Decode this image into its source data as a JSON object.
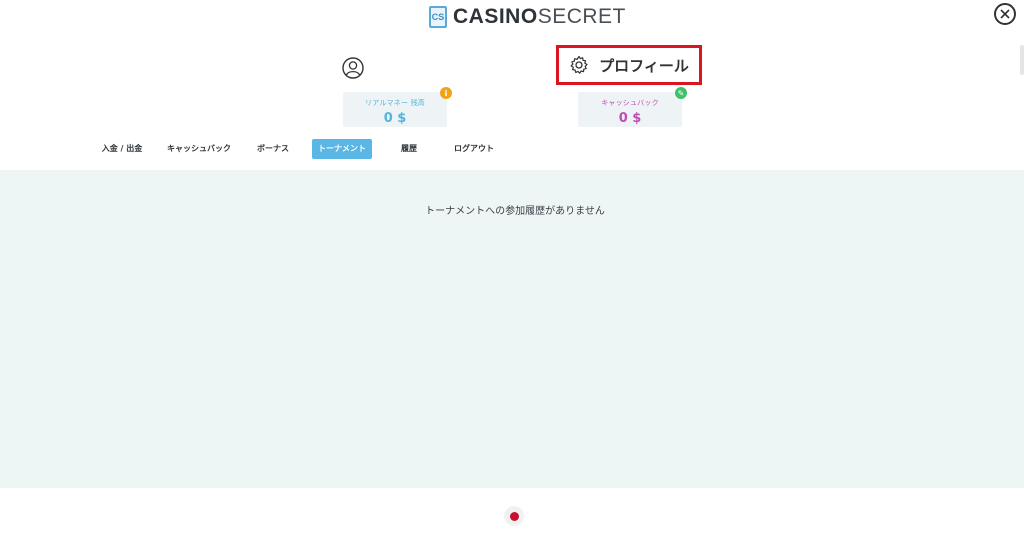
{
  "header": {
    "logo_mark": "CS",
    "logo_bold": "CASINO",
    "logo_light": "SECRET",
    "close_icon": "close-circle-icon"
  },
  "profile": {
    "user_icon": "user-circle-icon",
    "settings_icon": "gear-icon",
    "label": "プロフィール",
    "highlight_color": "#d9161d"
  },
  "balances": {
    "real_money": {
      "label": "リアルマネー 残高",
      "value": "0 $",
      "badge": "i",
      "color": "#54b4dd"
    },
    "cashback": {
      "label": "キャッシュバック",
      "value": "0 $",
      "badge": "✎",
      "color": "#c04db2"
    }
  },
  "tabs": [
    {
      "label": "入金 / 出金",
      "active": false
    },
    {
      "label": "キャッシュバック",
      "active": false
    },
    {
      "label": "ボーナス",
      "active": false
    },
    {
      "label": "トーナメント",
      "active": true
    },
    {
      "label": "履歴",
      "active": false
    },
    {
      "label": "ログアウト",
      "active": false
    }
  ],
  "main": {
    "empty_message": "トーナメントへの参加履歴がありません"
  },
  "colors": {
    "accent": "#5ab6e5",
    "content_bg": "#eef5f5",
    "dot": "#c8102e"
  }
}
